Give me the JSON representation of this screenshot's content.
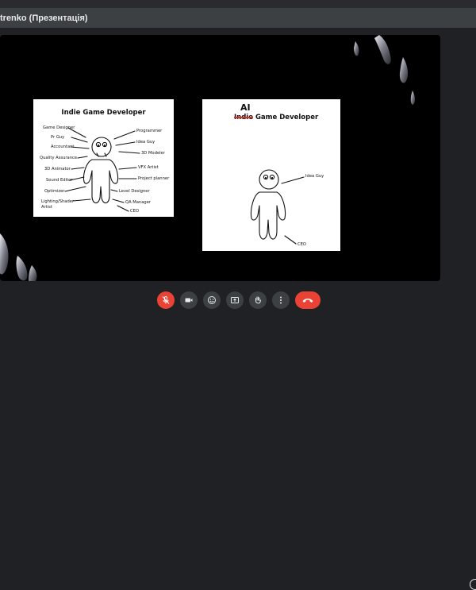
{
  "window": {
    "title": "trenko (Презентація)"
  },
  "slides": {
    "left": {
      "heading": "Indie Game Developer",
      "left_labels": [
        "Game Designer",
        "Pr Guy",
        "Accountant",
        "Quality Assurance",
        "3D Animator",
        "Sound Editor",
        "Optimizer",
        "Lighting/Shader Artist"
      ],
      "right_labels": [
        "Programmer",
        "Idea Guy",
        "3D Modeler",
        "VFX Artist",
        "Project planner",
        "Level Designer",
        "QA Manager",
        "CEO"
      ]
    },
    "right": {
      "strike_word": "Indie",
      "ai_word": "AI",
      "heading_rest": "Game Developer",
      "labels": [
        "Idea Guy",
        "CEO"
      ]
    }
  },
  "controls": {
    "mic": "mic-off-icon",
    "camera": "camera-icon",
    "emoji": "emoji-icon",
    "present": "present-screen-icon",
    "hand": "raise-hand-icon",
    "more": "more-options-icon",
    "end": "end-call-icon"
  },
  "colors": {
    "end_call": "#ea4335",
    "mic_off": "#ea4335",
    "control_bg": "#3c4043"
  }
}
